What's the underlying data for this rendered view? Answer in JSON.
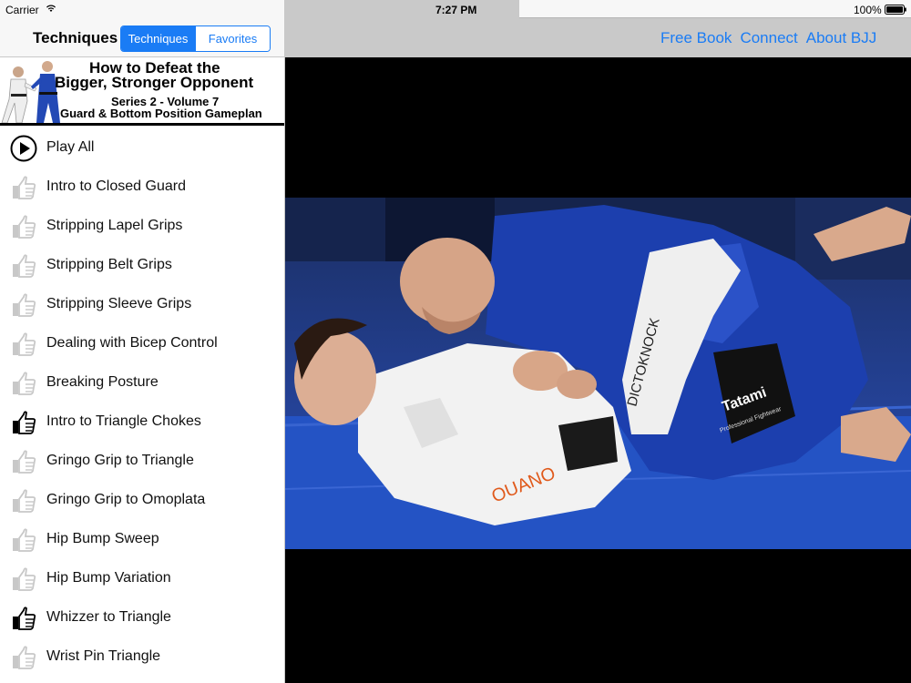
{
  "status_bar": {
    "carrier": "Carrier",
    "time": "7:27 PM",
    "battery": "100%"
  },
  "left_nav": {
    "title": "Techniques",
    "segments": [
      {
        "label": "Techniques",
        "selected": true
      },
      {
        "label": "Favorites",
        "selected": false
      }
    ]
  },
  "banner": {
    "line1": "How to Defeat the",
    "line2": "Bigger, Stronger Opponent",
    "line3": "Series 2 - Volume 7",
    "line4": "Guard & Bottom Position Gameplan"
  },
  "list": [
    {
      "label": "Play All",
      "icon": "play-icon"
    },
    {
      "label": "Intro to Closed Guard",
      "icon": "thumbs-up-icon",
      "favorited": false
    },
    {
      "label": "Stripping Lapel Grips",
      "icon": "thumbs-up-icon",
      "favorited": false
    },
    {
      "label": "Stripping Belt Grips",
      "icon": "thumbs-up-icon",
      "favorited": false
    },
    {
      "label": "Stripping Sleeve Grips",
      "icon": "thumbs-up-icon",
      "favorited": false
    },
    {
      "label": "Dealing with Bicep Control",
      "icon": "thumbs-up-icon",
      "favorited": false
    },
    {
      "label": "Breaking Posture",
      "icon": "thumbs-up-icon",
      "favorited": false
    },
    {
      "label": "Intro to Triangle Chokes",
      "icon": "thumbs-up-icon",
      "favorited": true
    },
    {
      "label": "Gringo Grip to Triangle",
      "icon": "thumbs-up-icon",
      "favorited": false
    },
    {
      "label": "Gringo Grip to Omoplata",
      "icon": "thumbs-up-icon",
      "favorited": false
    },
    {
      "label": "Hip Bump Sweep",
      "icon": "thumbs-up-icon",
      "favorited": false
    },
    {
      "label": "Hip Bump Variation",
      "icon": "thumbs-up-icon",
      "favorited": false
    },
    {
      "label": "Whizzer to Triangle",
      "icon": "thumbs-up-icon",
      "favorited": true
    },
    {
      "label": "Wrist Pin Triangle",
      "icon": "thumbs-up-icon",
      "favorited": false
    }
  ],
  "right_nav": {
    "links": [
      "Free Book",
      "Connect",
      "About BJJ"
    ]
  },
  "video": {
    "gi_text_1": "OUANO",
    "gi_text_2": "Tatami",
    "gi_text_3": "Professional Fightwear"
  },
  "colors": {
    "accent": "#1a7cf5",
    "icon_inactive": "#c8c8c8",
    "icon_active": "#000000",
    "mat_blue": "#1f57c9"
  }
}
